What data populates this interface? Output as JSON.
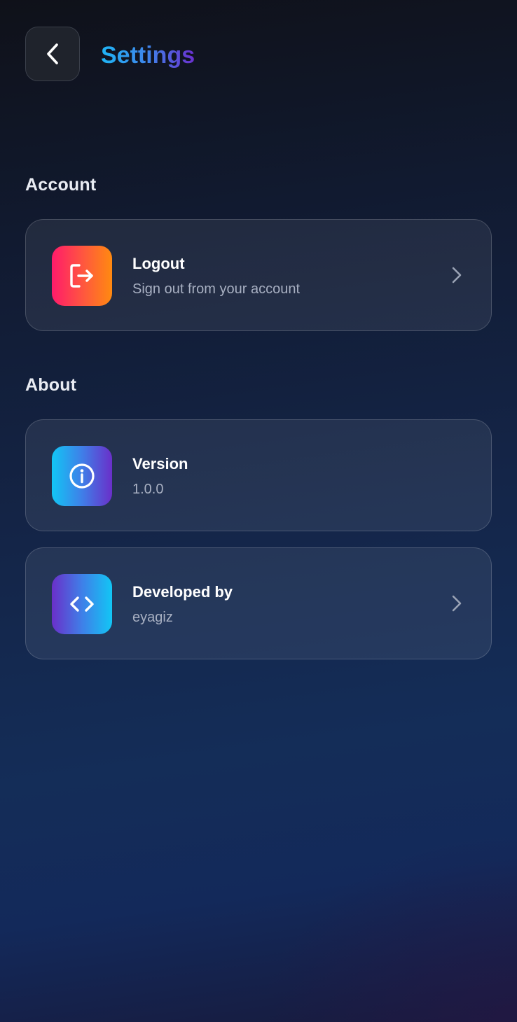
{
  "header": {
    "title": "Settings",
    "back_icon": "chevron-left-icon"
  },
  "sections": {
    "account": {
      "heading": "Account",
      "items": [
        {
          "title": "Logout",
          "subtitle": "Sign out from your account",
          "icon": "logout-icon",
          "colors": [
            "#ff1b6b",
            "#ff8a10"
          ]
        }
      ]
    },
    "about": {
      "heading": "About",
      "items": [
        {
          "title": "Version",
          "subtitle": "1.0.0",
          "icon": "info-icon",
          "colors": [
            "#12c6f5",
            "#6a2fc9"
          ]
        },
        {
          "title": "Developed by",
          "subtitle": "eyagiz",
          "icon": "code-icon",
          "colors": [
            "#6a2fc9",
            "#12c6f5"
          ]
        }
      ]
    }
  },
  "theme": {
    "title_gradient": [
      "#1fb5f5",
      "#6b2fcf"
    ],
    "background": "#142548",
    "card_border": "rgba(255,255,255,0.17)"
  }
}
